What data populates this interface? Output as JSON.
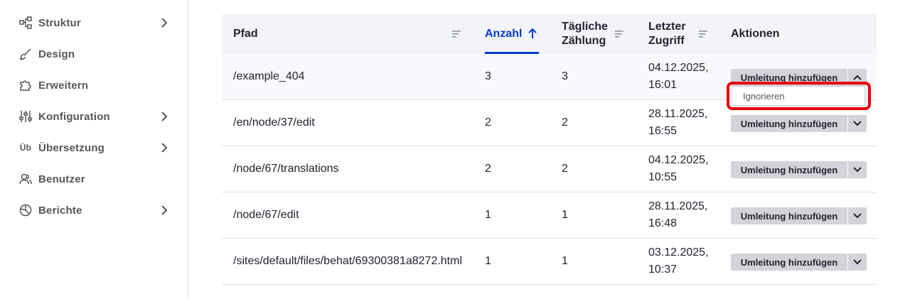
{
  "sidebar": {
    "items": [
      {
        "label": "Struktur",
        "icon": "structure-icon",
        "has_submenu": true
      },
      {
        "label": "Design",
        "icon": "brush-icon",
        "has_submenu": false
      },
      {
        "label": "Erweitern",
        "icon": "puzzle-icon",
        "has_submenu": false
      },
      {
        "label": "Konfiguration",
        "icon": "sliders-icon",
        "has_submenu": true
      },
      {
        "label": "Übersetzung",
        "icon": "translation-icon",
        "icon_text": "Üb",
        "has_submenu": true
      },
      {
        "label": "Benutzer",
        "icon": "users-icon",
        "has_submenu": false
      },
      {
        "label": "Berichte",
        "icon": "pie-chart-icon",
        "has_submenu": true
      }
    ]
  },
  "table": {
    "headers": {
      "path": "Pfad",
      "count": "Anzahl",
      "daily_count_line1": "Tägliche",
      "daily_count_line2": "Zählung",
      "last_access_line1": "Letzter",
      "last_access_line2": "Zugriff",
      "actions": "Aktionen"
    },
    "sorted_column": "Anzahl",
    "sort_direction": "ascending-arrow",
    "rows": [
      {
        "path": "/example_404",
        "count": "3",
        "daily": "3",
        "date": "04.12.2025,",
        "time": "16:01",
        "action": "Umleitung hinzufügen",
        "expanded": true
      },
      {
        "path": "/en/node/37/edit",
        "count": "2",
        "daily": "2",
        "date": "28.11.2025,",
        "time": "16:55",
        "action": "Umleitung hinzufügen",
        "expanded": false
      },
      {
        "path": "/node/67/translations",
        "count": "2",
        "daily": "2",
        "date": "04.12.2025,",
        "time": "10:55",
        "action": "Umleitung hinzufügen",
        "expanded": false
      },
      {
        "path": "/node/67/edit",
        "count": "1",
        "daily": "1",
        "date": "28.11.2025,",
        "time": "16:48",
        "action": "Umleitung hinzufügen",
        "expanded": false
      },
      {
        "path": "/sites/default/files/behat/69300381a8272.html",
        "count": "1",
        "daily": "1",
        "date": "03.12.2025,",
        "time": "10:37",
        "action": "Umleitung hinzufügen",
        "expanded": false
      }
    ]
  },
  "dropdown": {
    "item": "Ignorieren"
  },
  "colors": {
    "accent": "#003ecc",
    "highlight_border": "#e8000b",
    "button_bg": "#d3d4d9",
    "header_bg": "#f3f4f9",
    "sidebar_text": "#55565b"
  }
}
